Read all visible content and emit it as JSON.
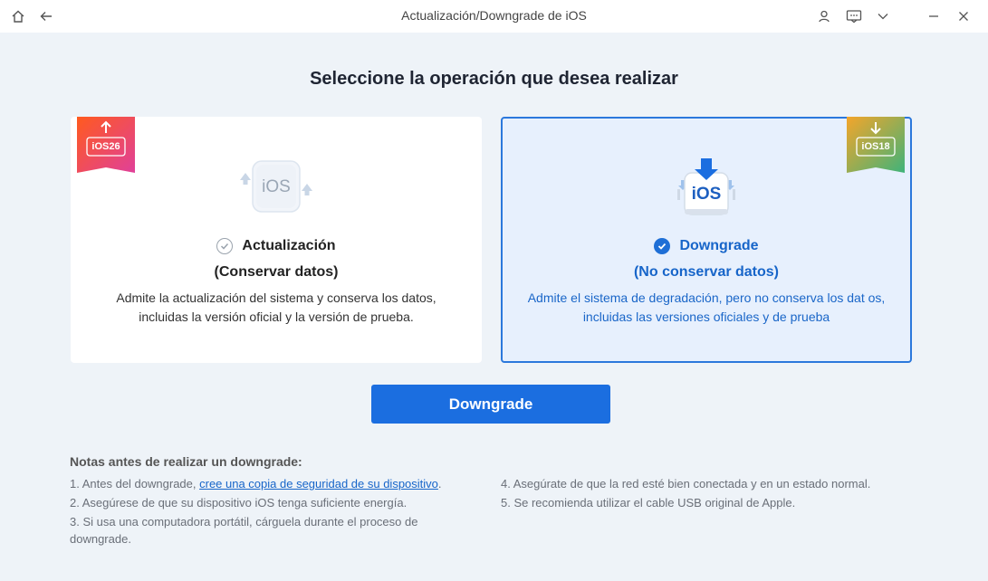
{
  "window": {
    "title": "Actualización/Downgrade de iOS"
  },
  "heading": "Seleccione la operación que desea realizar",
  "options": [
    {
      "badge": "iOS26",
      "icon_text": "iOS",
      "title": "Actualización",
      "subtitle": "(Conservar datos)",
      "description": "Admite la actualización del sistema y conserva los datos, incluidas la versión oficial y la versión de prueba.",
      "selected": false,
      "badge_colors": [
        "#ff5a1e",
        "#e0409a"
      ]
    },
    {
      "badge": "iOS18",
      "icon_text": "iOS",
      "title": "Downgrade",
      "subtitle": "(No conservar datos)",
      "description": "Admite el sistema de degradación, pero no conserva los dat os, incluidas las versiones oficiales y de prueba",
      "selected": true,
      "badge_colors": [
        "#f4a52a",
        "#3fb37a"
      ]
    }
  ],
  "primary_button": "Downgrade",
  "notes": {
    "title": "Notas antes de realizar un downgrade:",
    "items": [
      {
        "prefix": "1.  Antes del downgrade, ",
        "link": "cree una copia de seguridad de su dispositivo",
        "suffix": "."
      },
      {
        "text": "2.  Asegúrese de que su dispositivo iOS tenga suficiente energía."
      },
      {
        "text": "3.  Si usa una computadora portátil, cárguela durante el proceso de downgrade."
      },
      {
        "text": "4.  Asegúrate de que la red esté bien conectada y en un estado normal."
      },
      {
        "text": "5.  Se recomienda utilizar el cable USB original de Apple."
      }
    ]
  },
  "colors": {
    "accent": "#1b6ee0",
    "background": "#eef3f8"
  }
}
